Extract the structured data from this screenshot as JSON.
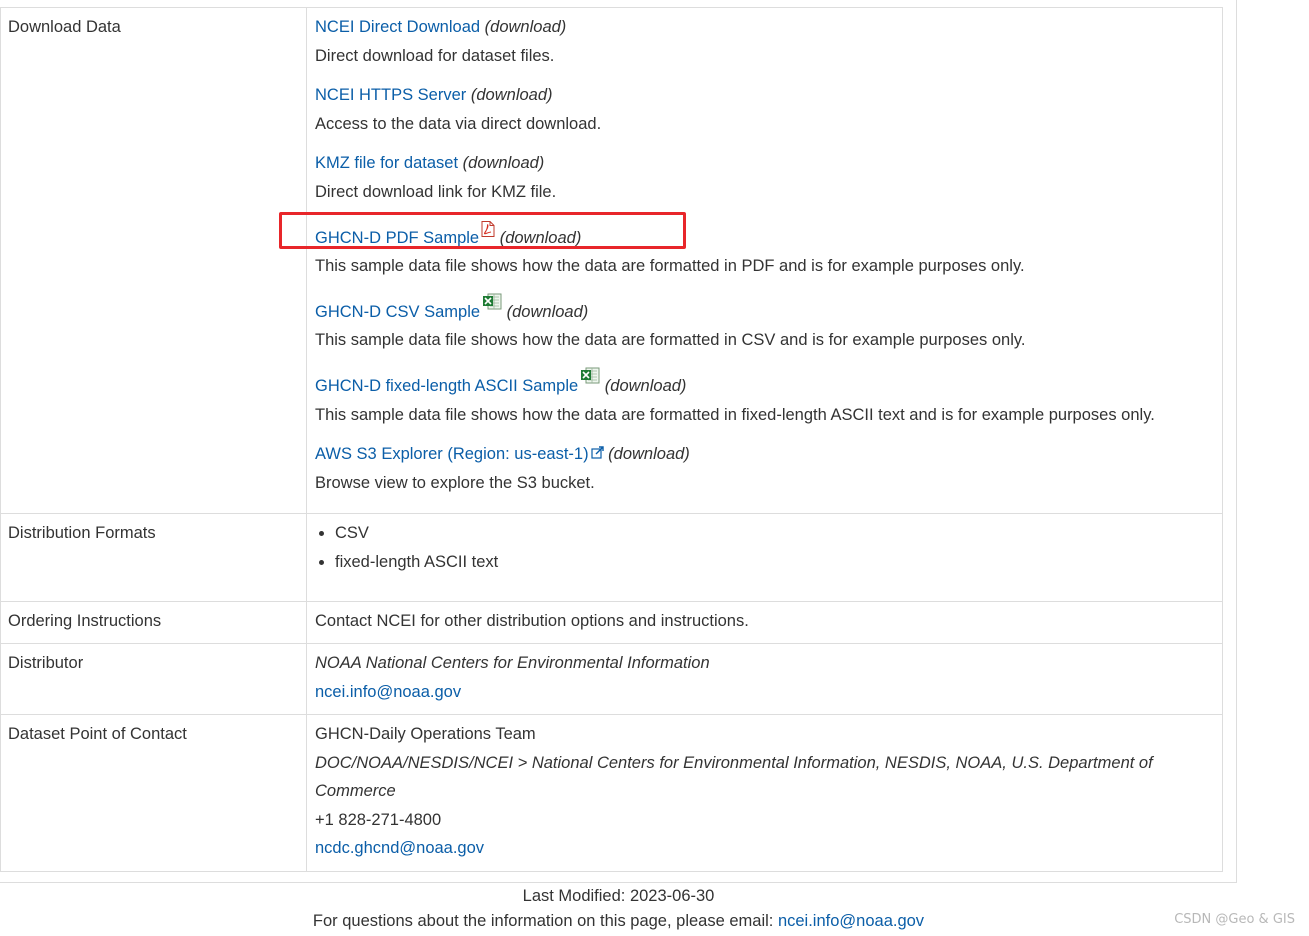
{
  "rows": {
    "download": {
      "label": "Download Data",
      "download_tag": "(download)",
      "links": [
        {
          "text": "NCEI Direct Download",
          "desc": "Direct download for dataset files."
        },
        {
          "text": "NCEI HTTPS Server",
          "desc": "Access to the data via direct download."
        },
        {
          "text": "KMZ file for dataset",
          "desc": "Direct download link for KMZ file."
        },
        {
          "text": "GHCN-D PDF Sample",
          "desc": "This sample data file shows how the data are formatted in PDF and is for example purposes only.",
          "icon": "pdf-icon"
        },
        {
          "text": "GHCN-D CSV Sample",
          "desc": "This sample data file shows how the data are formatted in CSV and is for example purposes only.",
          "icon": "excel-icon"
        },
        {
          "text": "GHCN-D fixed-length ASCII Sample",
          "desc": "This sample data file shows how the data are formatted in fixed-length ASCII text and is for example purposes only.",
          "icon": "excel-icon"
        },
        {
          "text": "AWS S3 Explorer (Region: us-east-1)",
          "desc": "Browse view to explore the S3 bucket.",
          "icon": "external-link-icon"
        }
      ]
    },
    "formats": {
      "label": "Distribution Formats",
      "items": [
        "CSV",
        "fixed-length ASCII text"
      ]
    },
    "ordering": {
      "label": "Ordering Instructions",
      "value": "Contact NCEI for other distribution options and instructions."
    },
    "distributor": {
      "label": "Distributor",
      "org": "NOAA National Centers for Environmental Information",
      "email": "ncei.info@noaa.gov"
    },
    "contact": {
      "label": "Dataset Point of Contact",
      "team": "GHCN-Daily Operations Team",
      "org": "DOC/NOAA/NESDIS/NCEI > National Centers for Environmental Information, NESDIS, NOAA, U.S. Department of Commerce",
      "phone": "+1 828-271-4800",
      "email": "ncdc.ghcnd@noaa.gov"
    }
  },
  "footer": {
    "last_modified": "Last Modified: 2023-06-30",
    "questions_text": "For questions about the information on this page, please email: ",
    "email": "ncei.info@noaa.gov"
  },
  "watermark": "CSDN @Geo & GIS",
  "colors": {
    "link": "#0b5ea8",
    "highlight": "#e8262a",
    "border": "#dddddd"
  }
}
